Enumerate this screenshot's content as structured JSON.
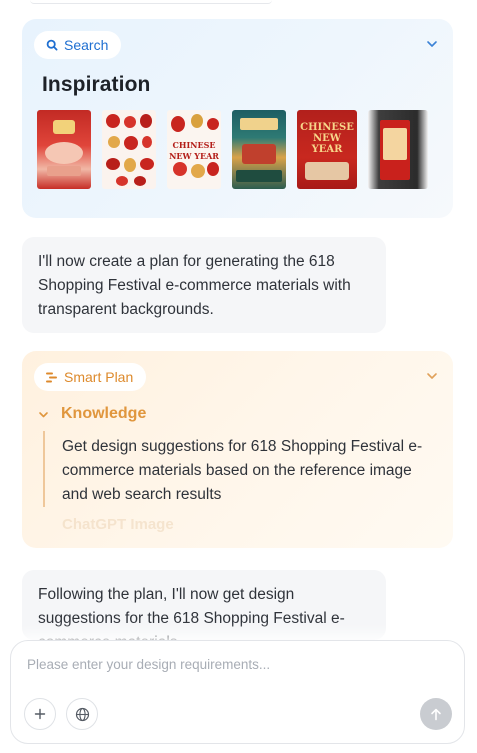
{
  "search_card": {
    "tag_label": "Search",
    "title": "Inspiration",
    "thumbnails": [
      {
        "icon": "lantern-poster-thumbnail"
      },
      {
        "icon": "decorations-collage-thumbnail"
      },
      {
        "icon": "chinese-new-year-elements-thumbnail",
        "text": "CHINESE NEW YEAR"
      },
      {
        "icon": "festival-building-poster-thumbnail"
      },
      {
        "icon": "chinese-new-year-red-poster-thumbnail",
        "text": "CHINESE NEW YEAR"
      },
      {
        "icon": "red-banner-thumbnail"
      }
    ]
  },
  "messages": {
    "plan_intro": "I'll now create a plan for generating the 618 Shopping Festival e-commerce materials with transparent backgrounds.",
    "follow_up": "Following the plan, I'll now get design suggestions for the 618 Shopping Festival e-commerce materials."
  },
  "plan_card": {
    "tag_label": "Smart Plan",
    "step_title": "Knowledge",
    "step_description": "Get design suggestions for 618 Shopping Festival e-commerce materials based on the reference image and web search results",
    "next_step_faded": "ChatGPT Image"
  },
  "input": {
    "placeholder": "Please enter your design requirements..."
  },
  "colors": {
    "search_accent": "#1f6fd1",
    "plan_accent": "#e0963d"
  }
}
